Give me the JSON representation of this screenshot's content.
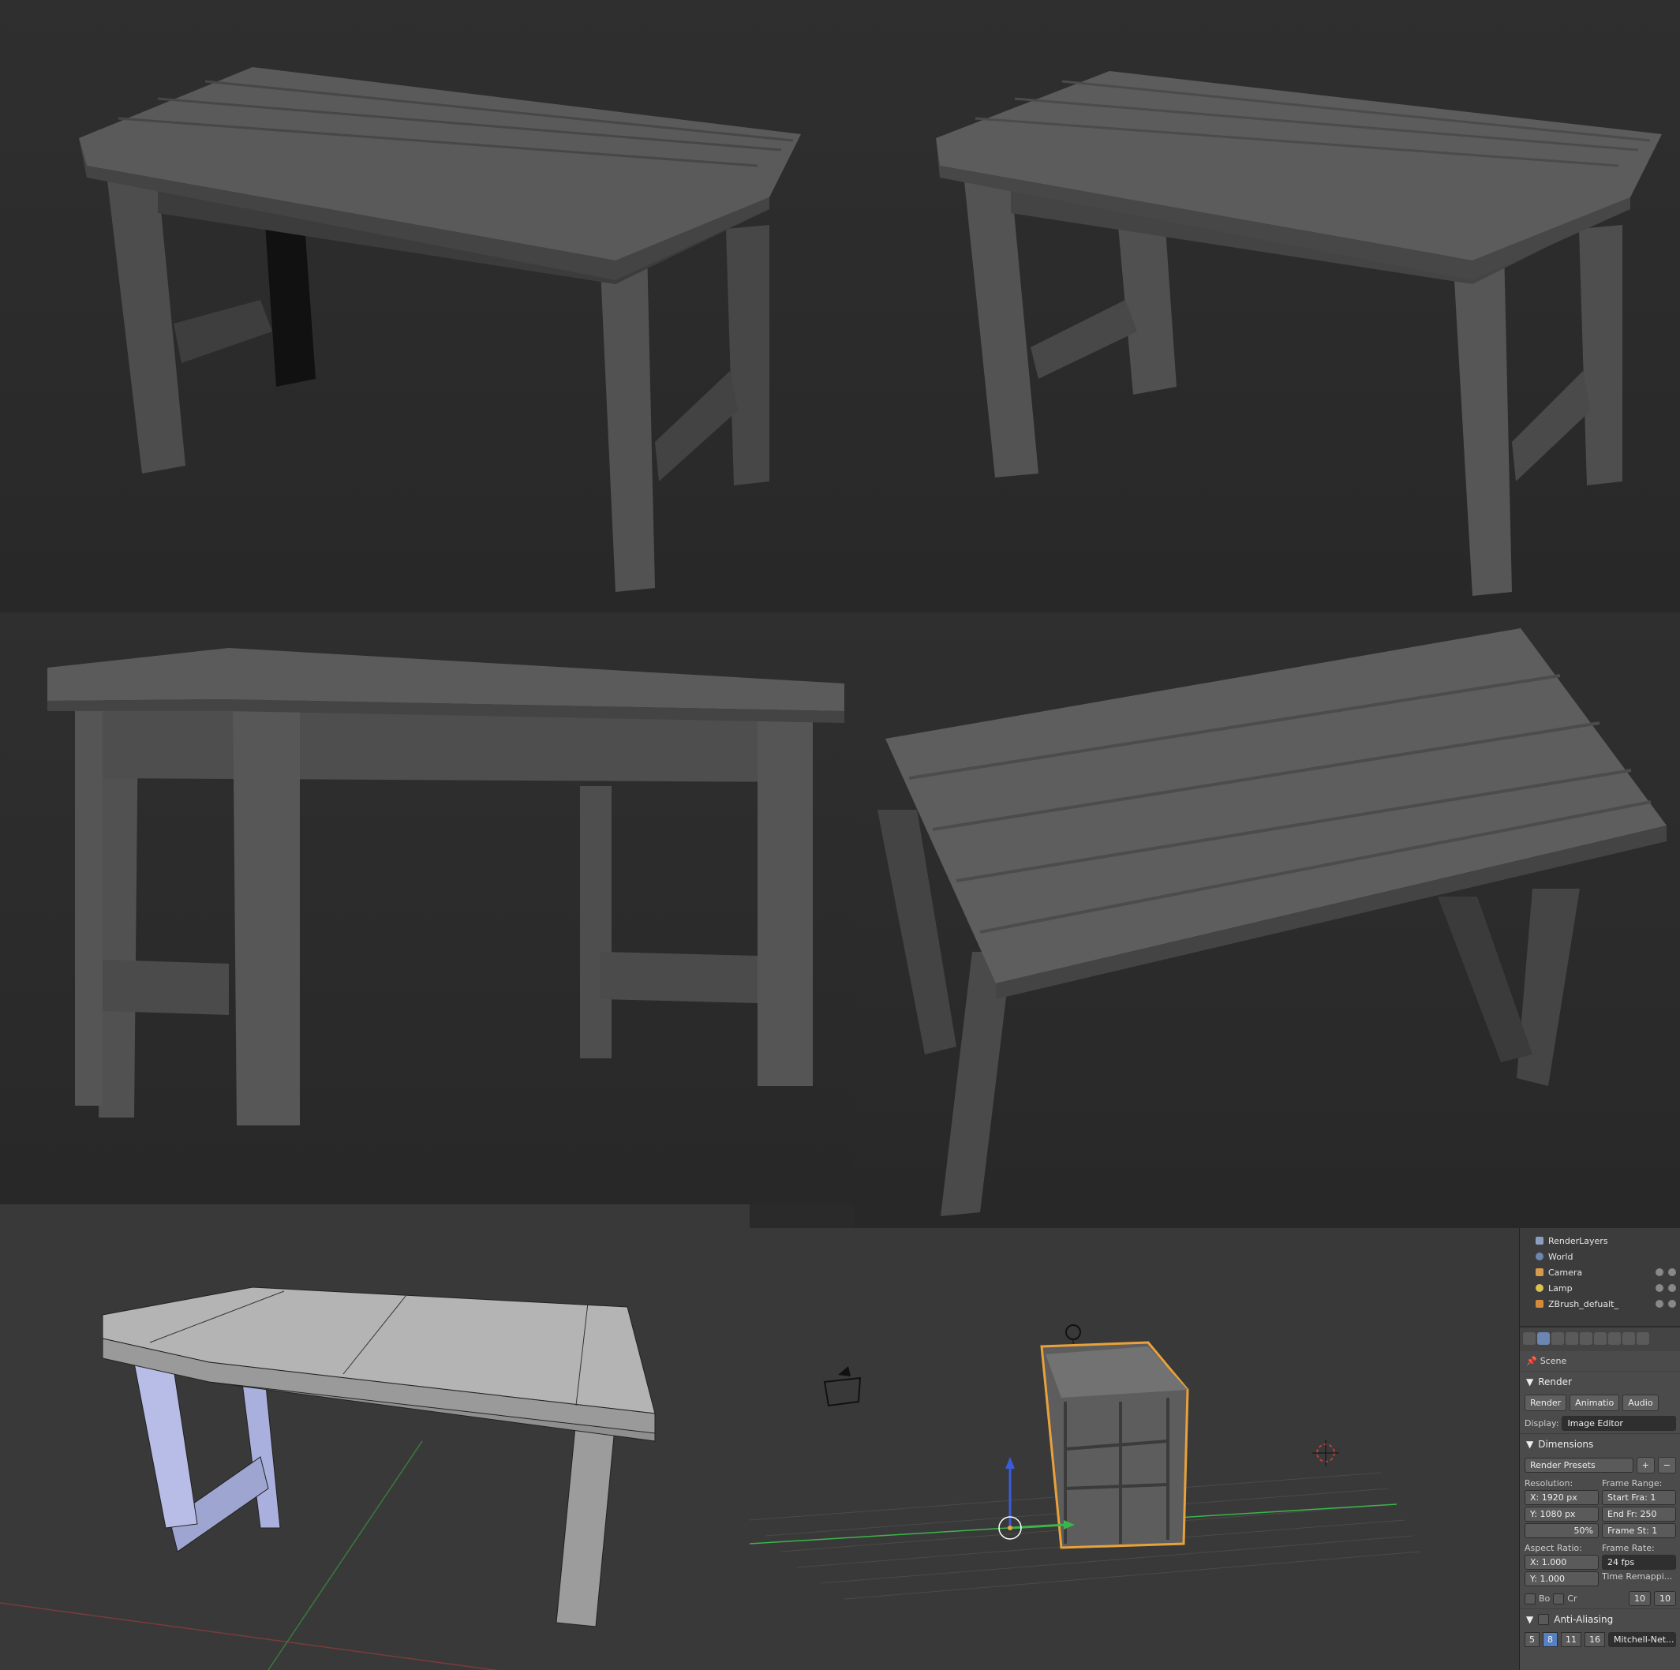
{
  "outliner": {
    "items": [
      {
        "label": "RenderLayers",
        "icon": "render-layers-icon",
        "color": "#8a9fbf"
      },
      {
        "label": "World",
        "icon": "world-icon",
        "color": "#6b86b0"
      },
      {
        "label": "Camera",
        "icon": "camera-icon",
        "color": "#d59b4d"
      },
      {
        "label": "Lamp",
        "icon": "lamp-icon",
        "color": "#d9c24f"
      },
      {
        "label": "ZBrush_defualt_",
        "icon": "mesh-icon",
        "color": "#d18b3a"
      }
    ]
  },
  "properties": {
    "scene_label": "Scene",
    "render_section": "Render",
    "buttons": {
      "render": "Render",
      "animation": "Animatio",
      "audio": "Audio"
    },
    "display_label": "Display:",
    "display_value": "Image Editor",
    "dimensions_section": "Dimensions",
    "render_presets": "Render Presets",
    "resolution_label": "Resolution:",
    "res_x": "X: 1920 px",
    "res_y": "Y: 1080 px",
    "res_pct": "50%",
    "frame_range_label": "Frame Range:",
    "start_frame": "Start Fra: 1",
    "end_frame": "End Fr: 250",
    "frame_step": "Frame St: 1",
    "aspect_label": "Aspect Ratio:",
    "aspect_x": "X:      1.000",
    "aspect_y": "Y:      1.000",
    "frame_rate_label": "Frame Rate:",
    "frame_rate": "24 fps",
    "time_remap_label": "Time Remappi...",
    "remap_old": "10",
    "remap_new": "10",
    "border_label": "Bo",
    "crop_label": "Cr",
    "aa_section": "Anti-Aliasing",
    "aa_samples": [
      "5",
      "8",
      "11",
      "16"
    ],
    "aa_selected": "8",
    "aa_filter": "Mitchell-Net..."
  },
  "colors": {
    "accent": "#5680c2",
    "selection_outline": "#e9a23b",
    "axis_x": "#c23b3b",
    "axis_y": "#3bb54a",
    "axis_z": "#3b5bd9"
  }
}
